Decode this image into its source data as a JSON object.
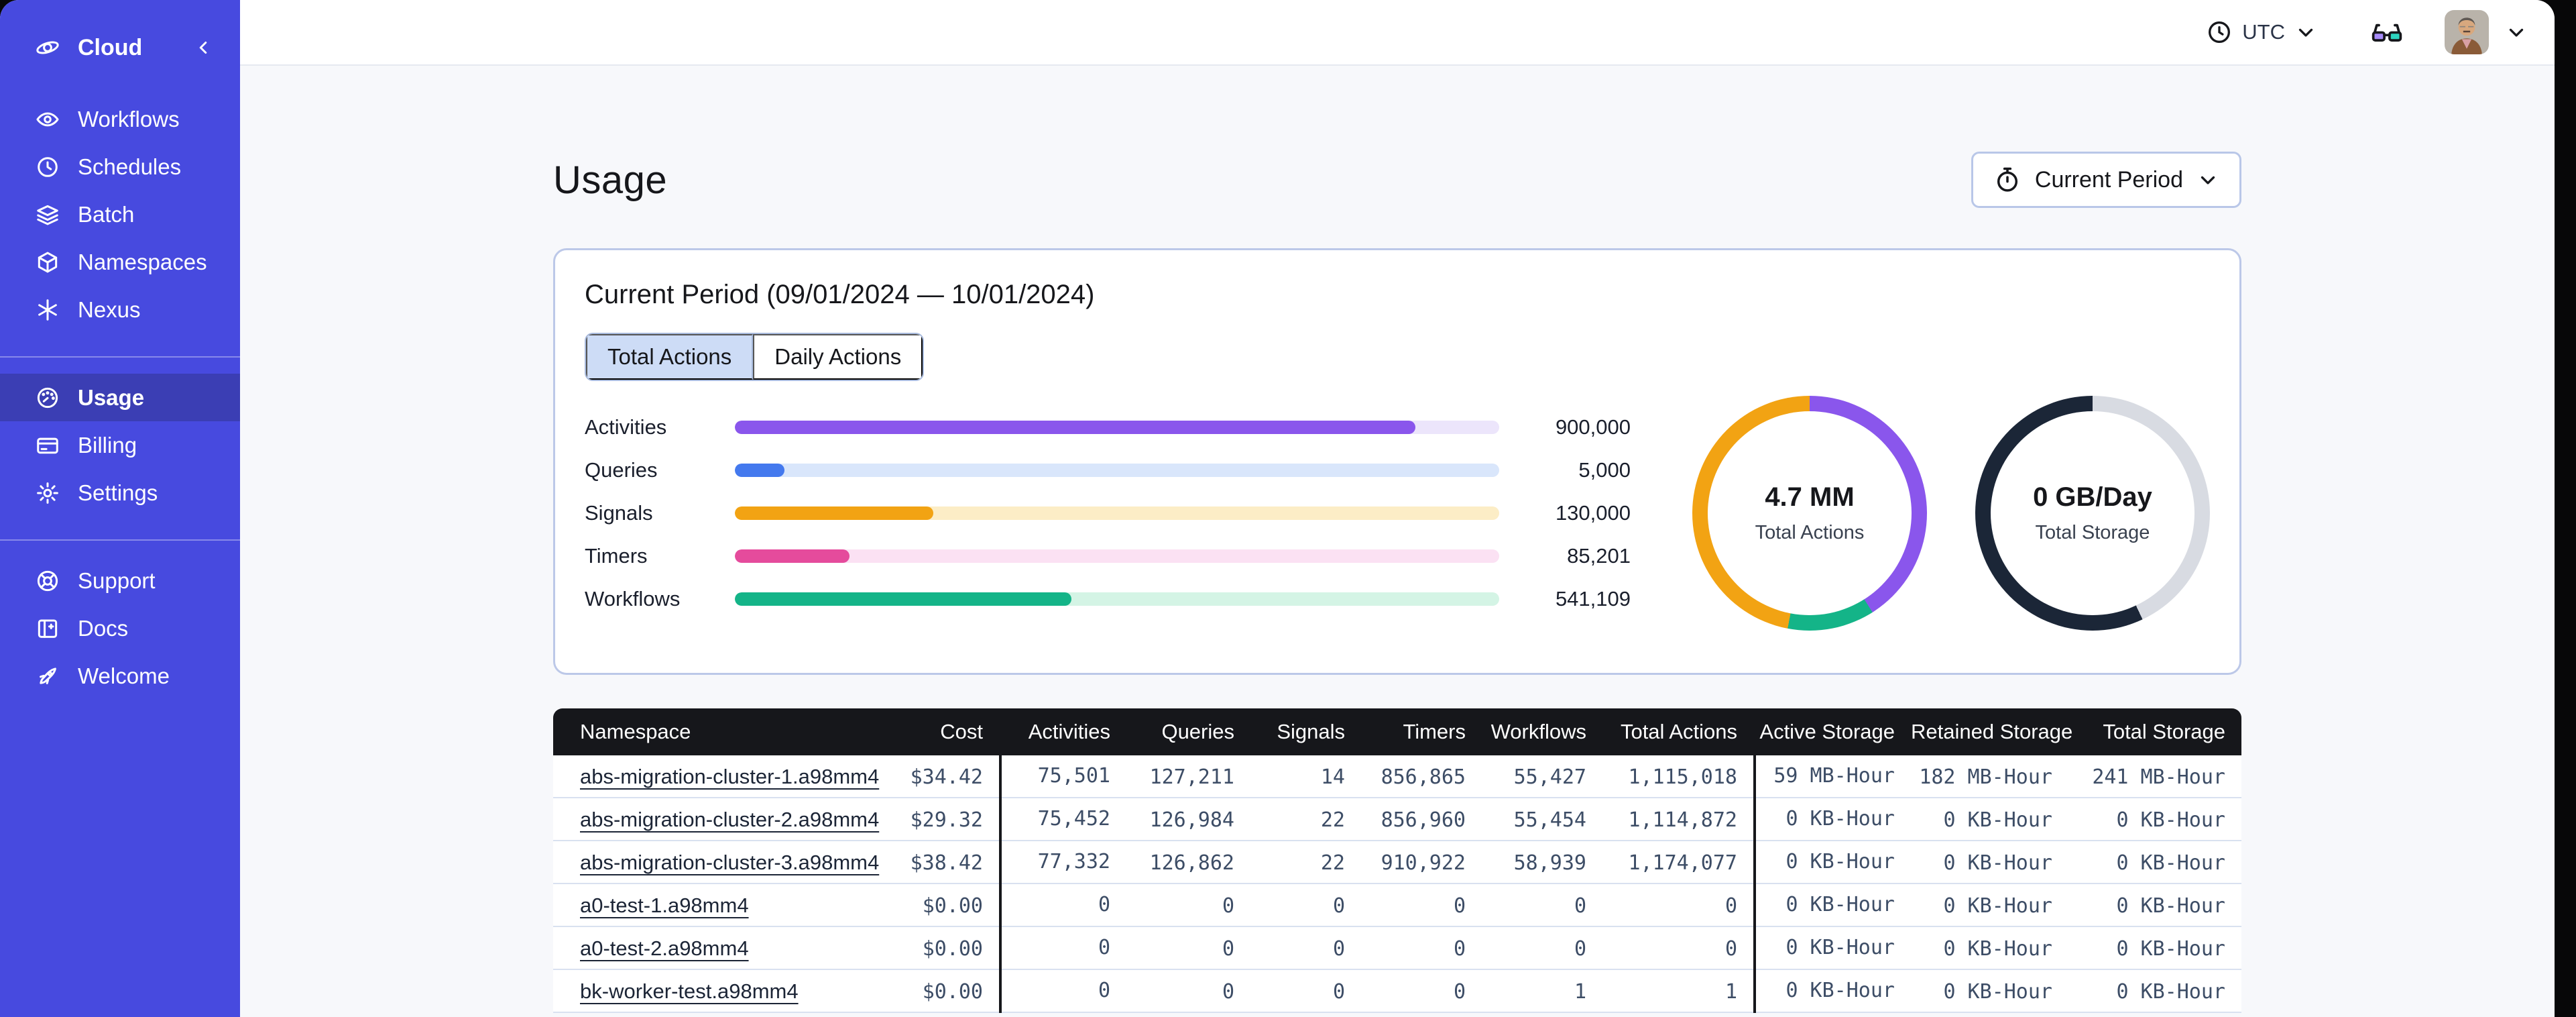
{
  "sidebar": {
    "brand_label": "Cloud",
    "nav_primary": [
      {
        "label": "Workflows",
        "icon": "workflows-icon"
      },
      {
        "label": "Schedules",
        "icon": "schedules-icon"
      },
      {
        "label": "Batch",
        "icon": "batch-icon"
      },
      {
        "label": "Namespaces",
        "icon": "namespaces-icon"
      },
      {
        "label": "Nexus",
        "icon": "nexus-icon"
      }
    ],
    "nav_account": [
      {
        "label": "Usage",
        "icon": "usage-icon",
        "active": true
      },
      {
        "label": "Billing",
        "icon": "billing-icon"
      },
      {
        "label": "Settings",
        "icon": "settings-icon"
      }
    ],
    "nav_footer": [
      {
        "label": "Support",
        "icon": "support-icon"
      },
      {
        "label": "Docs",
        "icon": "docs-icon"
      },
      {
        "label": "Welcome",
        "icon": "welcome-icon"
      }
    ]
  },
  "topbar": {
    "timezone_label": "UTC"
  },
  "page": {
    "title": "Usage",
    "period_selector_label": "Current Period"
  },
  "usage_card": {
    "title": "Current Period (09/01/2024 — 10/01/2024)",
    "tabs": [
      {
        "label": "Total Actions",
        "active": true
      },
      {
        "label": "Daily Actions",
        "active": false
      }
    ]
  },
  "chart_data": [
    {
      "type": "bar",
      "orientation": "horizontal",
      "title": "Total Actions by type",
      "categories": [
        "Activities",
        "Queries",
        "Signals",
        "Timers",
        "Workflows"
      ],
      "values": [
        900000,
        5000,
        130000,
        85201,
        541109
      ],
      "value_labels": [
        "900,000",
        "5,000",
        "130,000",
        "85,201",
        "541,109"
      ],
      "fill_pct": [
        89,
        6.5,
        26,
        15,
        44
      ],
      "colors": [
        "#8a56ec",
        "#4479ee",
        "#f2a313",
        "#e54b9c",
        "#14b488"
      ],
      "track_colors": [
        "#ece5fb",
        "#d9e6fb",
        "#fcedc6",
        "#fbe1f3",
        "#d4f4e5"
      ],
      "grid": false,
      "legend": false
    },
    {
      "type": "pie",
      "subtype": "donut",
      "center_label": "4.7 MM",
      "sub_label": "Total Actions",
      "segments": [
        {
          "name": "activities",
          "color": "#8a56ec",
          "pct": 41
        },
        {
          "name": "workflows",
          "color": "#14b488",
          "pct": 12
        },
        {
          "name": "signals",
          "color": "#f2a313",
          "pct": 47
        }
      ]
    },
    {
      "type": "pie",
      "subtype": "donut",
      "center_label": "0 GB/Day",
      "sub_label": "Total Storage",
      "segments": [
        {
          "name": "remaining",
          "color": "#d8dbe2",
          "pct": 43
        },
        {
          "name": "storage",
          "color": "#1b2637",
          "pct": 57
        }
      ]
    }
  ],
  "table": {
    "columns": [
      "Namespace",
      "Cost",
      "Activities",
      "Queries",
      "Signals",
      "Timers",
      "Workflows",
      "Total Actions",
      "Active Storage",
      "Retained Storage",
      "Total Storage"
    ],
    "rows": [
      [
        "abs-migration-cluster-1.a98mm4",
        "$34.42",
        "75,501",
        "127,211",
        "14",
        "856,865",
        "55,427",
        "1,115,018",
        "59 MB-Hour",
        "182 MB-Hour",
        "241 MB-Hour"
      ],
      [
        "abs-migration-cluster-2.a98mm4",
        "$29.32",
        "75,452",
        "126,984",
        "22",
        "856,960",
        "55,454",
        "1,114,872",
        "0 KB-Hour",
        "0 KB-Hour",
        "0 KB-Hour"
      ],
      [
        "abs-migration-cluster-3.a98mm4",
        "$38.42",
        "77,332",
        "126,862",
        "22",
        "910,922",
        "58,939",
        "1,174,077",
        "0 KB-Hour",
        "0 KB-Hour",
        "0 KB-Hour"
      ],
      [
        "a0-test-1.a98mm4",
        "$0.00",
        "0",
        "0",
        "0",
        "0",
        "0",
        "0",
        "0 KB-Hour",
        "0 KB-Hour",
        "0 KB-Hour"
      ],
      [
        "a0-test-2.a98mm4",
        "$0.00",
        "0",
        "0",
        "0",
        "0",
        "0",
        "0",
        "0 KB-Hour",
        "0 KB-Hour",
        "0 KB-Hour"
      ],
      [
        "bk-worker-test.a98mm4",
        "$0.00",
        "0",
        "0",
        "0",
        "0",
        "1",
        "1",
        "0 KB-Hour",
        "0 KB-Hour",
        "0 KB-Hour"
      ]
    ]
  },
  "colors": {
    "sidebar_bg": "#474adf",
    "sidebar_active_bg": "#3b3eb4",
    "page_bg": "#f7f8fb",
    "card_border": "#bcc8e8",
    "table_header_bg": "#16171b",
    "tab_active_bg": "#cddcf6"
  }
}
